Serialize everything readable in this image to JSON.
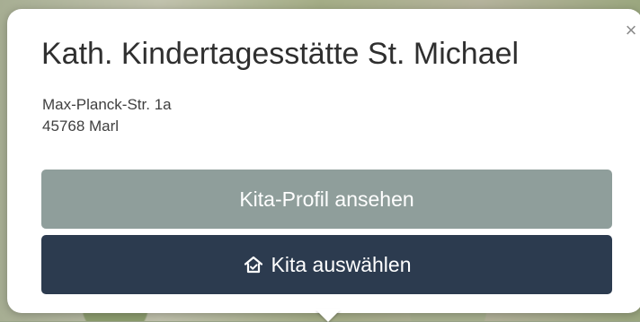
{
  "popup": {
    "title": "Kath. Kindertagesstätte St. Michael",
    "address_line_1": "Max-Planck-Str. 1a",
    "address_line_2": "45768 Marl",
    "close_label": "×",
    "profile_button_label": "Kita-Profil ansehen",
    "select_button_label": "Kita auswählen",
    "select_icon": "house-icon"
  },
  "colors": {
    "profile_button": "#8f9e9b",
    "select_button": "#2c3b4f",
    "title_text": "#2f2f2f"
  }
}
